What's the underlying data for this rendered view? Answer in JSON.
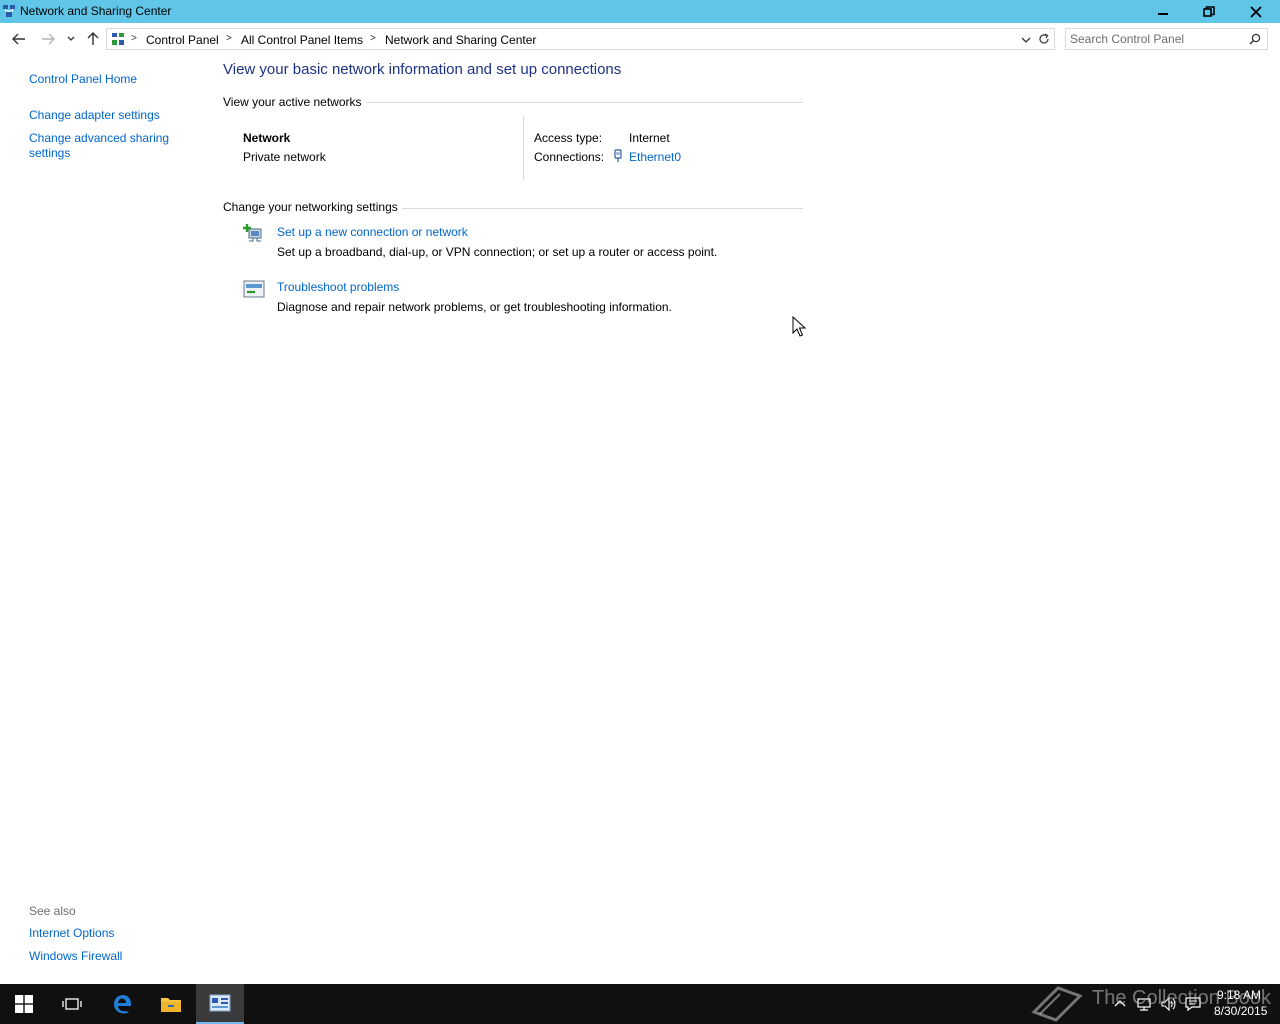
{
  "window": {
    "title": "Network and Sharing Center"
  },
  "address": {
    "crumbs": [
      "Control Panel",
      "All Control Panel Items",
      "Network and Sharing Center"
    ]
  },
  "search": {
    "placeholder": "Search Control Panel"
  },
  "sidebar": {
    "links": [
      "Control Panel Home",
      "Change adapter settings",
      "Change advanced sharing settings"
    ],
    "see_also_label": "See also",
    "see_also": [
      "Internet Options",
      "Windows Firewall"
    ]
  },
  "main": {
    "title": "View your basic network information and set up connections",
    "active_networks_heading": "View your active networks",
    "network": {
      "name": "Network",
      "type": "Private network",
      "access_type_label": "Access type:",
      "access_type_value": "Internet",
      "connections_label": "Connections:",
      "connections_value": "Ethernet0"
    },
    "settings_heading": "Change your networking settings",
    "tasks": [
      {
        "title": "Set up a new connection or network",
        "description": "Set up a broadband, dial-up, or VPN connection; or set up a router or access point."
      },
      {
        "title": "Troubleshoot problems",
        "description": "Diagnose and repair network problems, or get troubleshooting information."
      }
    ]
  },
  "taskbar": {
    "time": "9:18 AM",
    "date": "8/30/2015",
    "watermark": "The Collection Book"
  },
  "icons": {
    "app": "network-center-icon",
    "back": "back-arrow-icon",
    "forward": "forward-arrow-icon",
    "up": "up-arrow-icon",
    "search": "search-icon"
  },
  "colors": {
    "titlebar": "#5fc6e8",
    "link": "#0066cc",
    "heading": "#1e3287",
    "taskbar": "#101010"
  }
}
